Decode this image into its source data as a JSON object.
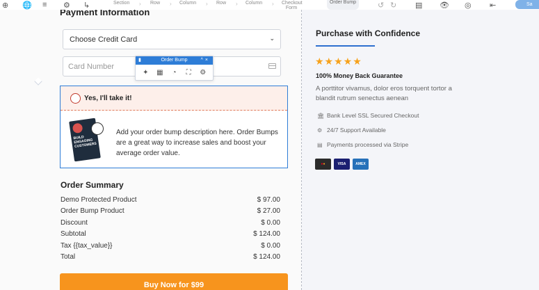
{
  "toolbar": {
    "crumbs": [
      "Section",
      "Row",
      "Column",
      "Row",
      "Column",
      "Checkout Form",
      "Order Bump"
    ],
    "save_label": "Sa",
    "icons": [
      "add-icon",
      "globe-icon",
      "layers-icon",
      "settings-icon",
      "code-icon",
      "undo-icon",
      "redo-icon",
      "responsive-icon",
      "preview-icon",
      "help-icon",
      "exit-icon"
    ]
  },
  "payment": {
    "title": "Payment Information",
    "select_label": "Choose Credit Card",
    "card_placeholder": "Card Number"
  },
  "order_bump_toolbar": {
    "title": "Order Bump",
    "tools": [
      "magic-wand-icon",
      "calendar-icon",
      "palette-icon",
      "expand-icon",
      "gear-icon"
    ]
  },
  "bump": {
    "yes_label": "Yes, I'll take it!",
    "description": "Add your order bump description here. Order Bumps are a great way to increase sales and boost your average order value.",
    "book_text": "BUILD ENGAGING CUSTOMERS"
  },
  "order_summary": {
    "title": "Order Summary",
    "rows": [
      {
        "label": "Demo Protected Product",
        "value": "$ 97.00"
      },
      {
        "label": "Order Bump Product",
        "value": "$ 27.00"
      },
      {
        "label": "Discount",
        "value": "$ 0.00"
      },
      {
        "label": "Subtotal",
        "value": "$ 124.00"
      },
      {
        "label": "Tax {{tax_value}}",
        "value": "$ 0.00"
      },
      {
        "label": "Total",
        "value": "$ 124.00"
      }
    ]
  },
  "buy_button": "Buy Now for $99",
  "confidence": {
    "title": "Purchase with Confidence",
    "stars": "★★★★★",
    "guarantee": "100% Money Back Guarantee",
    "text": "A porttitor vivamus, dolor eros torquent tortor a blandit rutrum senectus aenean",
    "features": [
      {
        "icon": "bank-icon",
        "label": "Bank Level SSL Secured Checkout"
      },
      {
        "icon": "support-icon",
        "label": "24/7 Support Available"
      },
      {
        "icon": "card-icon",
        "label": "Payments processed via Stripe"
      }
    ],
    "cards": [
      "MC",
      "VISA",
      "AMEX"
    ]
  },
  "colors": {
    "accent_blue": "#2e7dd7",
    "buy_orange": "#f7941d",
    "star_gold": "#f7a21b",
    "bump_bg": "#fdefea"
  }
}
